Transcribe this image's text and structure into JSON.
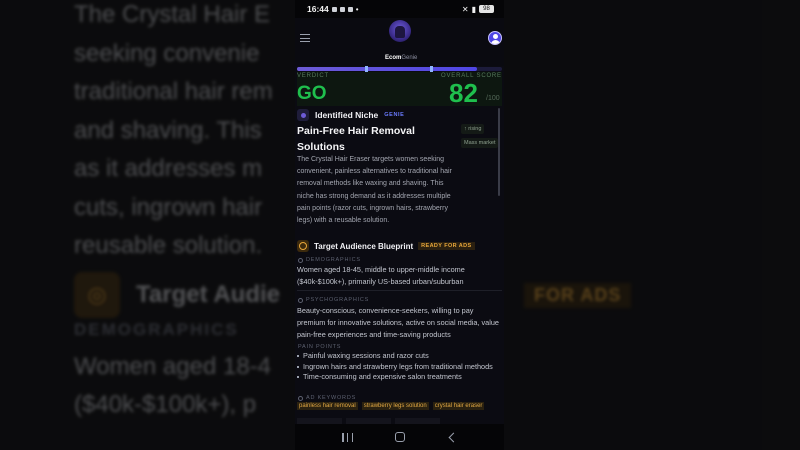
{
  "background": {
    "lines": [
      "The Crystal Hair E",
      "seeking convenie",
      "traditional hair rem",
      "and shaving. This",
      "as it addresses m",
      "cuts, ingrown hair",
      "reusable solution."
    ],
    "target_title": "Target Audie",
    "badge": "FOR ADS",
    "demographics": "DEMOGRAPHICS",
    "body_lines": [
      "Women aged 18-4",
      "($40k-$100k+), p"
    ]
  },
  "status_bar": {
    "time": "16:44",
    "battery": "98"
  },
  "app": {
    "brand_prefix": "Ecom",
    "brand_suffix": "Genie"
  },
  "progress": {
    "fraction": 0.88
  },
  "verdict": {
    "label": "VERDICT",
    "value": "GO",
    "score_label": "OVERALL SCORE",
    "score": "82",
    "score_max": "/100"
  },
  "niche": {
    "heading": "Identified Niche",
    "tag": "GENIE",
    "name": "Pain-Free Hair Removal Solutions",
    "side_tags": [
      "↑ rising",
      "Mass market"
    ],
    "description": "The Crystal Hair Eraser targets women seeking convenient, painless alternatives to traditional hair removal methods like waxing and shaving. This niche has strong demand as it addresses multiple pain points (razor cuts, ingrown hairs, strawberry legs) with a reusable solution."
  },
  "target": {
    "heading": "Target Audience Blueprint",
    "badge": "READY FOR ADS",
    "demographics_label": "DEMOGRAPHICS",
    "demographics": "Women aged 18-45, middle to upper-middle income ($40k-$100k+), primarily US-based urban/suburban",
    "psychographics_label": "PSYCHOGRAPHICS",
    "psychographics": "Beauty-conscious, convenience-seekers, willing to pay premium for innovative solutions, active on social media, value pain-free experiences and time-saving products",
    "pain_points_label": "PAIN POINTS",
    "pain_points": [
      "Painful waxing sessions and razor cuts",
      "Ingrown hairs and strawberry legs from traditional methods",
      "Time-consuming and expensive salon treatments"
    ],
    "keywords_label": "AD KEYWORDS",
    "keywords": [
      "painless hair removal",
      "strawberry legs solution",
      "crystal hair eraser"
    ]
  },
  "nav": {
    "recents": "recents",
    "home": "home",
    "back": "back"
  }
}
